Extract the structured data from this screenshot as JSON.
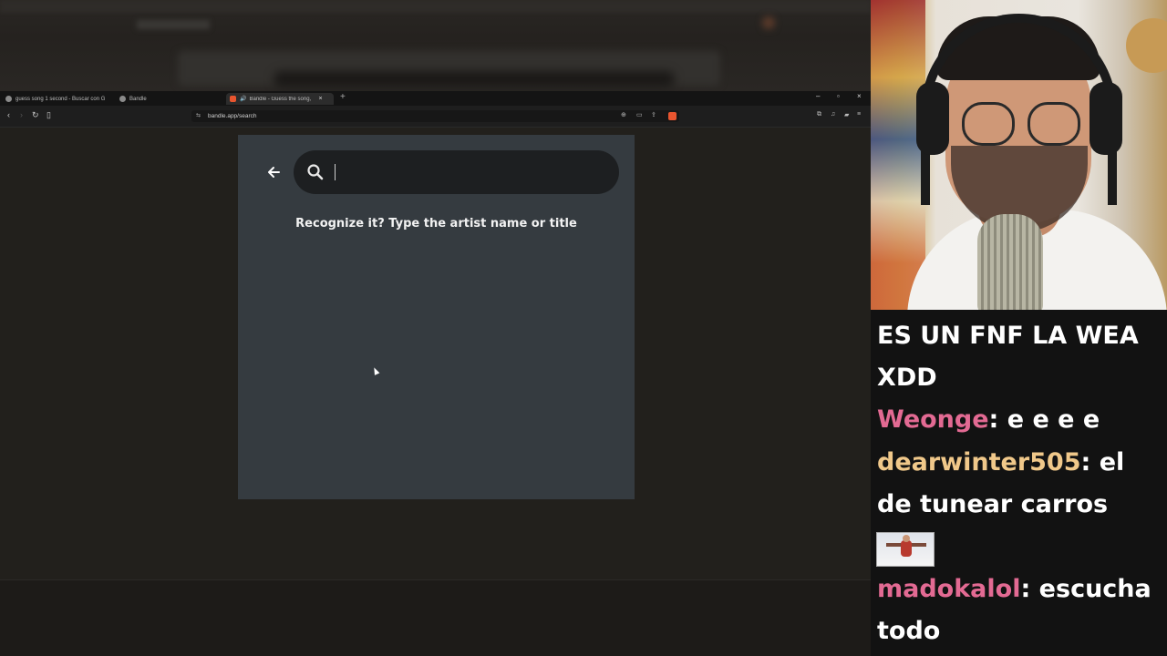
{
  "browser": {
    "tabs": [
      {
        "label": "guess song 1 second - Buscar con G",
        "favicon_color": "#8a8a8a"
      },
      {
        "label": "Bandle",
        "favicon_color": "#8a8a8a"
      },
      {
        "label": "Bandle - Guess the song, one",
        "favicon_color": "#e8552f"
      }
    ],
    "active_tab_index": 2,
    "url": "bandle.app/search"
  },
  "bandle": {
    "search_placeholder": "",
    "prompt": "Recognize it? Type the artist name or title"
  },
  "chat": {
    "messages": [
      {
        "user": "",
        "text_lines": [
          "ES UN FNF LA WEA",
          "XDD"
        ]
      },
      {
        "user": "Weonge",
        "user_color": "#e36a93",
        "text_lines": [
          " e e e e"
        ]
      },
      {
        "user": "dearwinter505",
        "user_color": "#f0c88a",
        "text_lines": [
          " el",
          "de tunear carros"
        ]
      },
      {
        "user": "madokalol",
        "user_color": "#e36a93",
        "text_lines": [
          " escucha",
          "todo"
        ]
      }
    ],
    "colors": {
      "pink": "#e36a93",
      "gold": "#f0c88a"
    }
  }
}
